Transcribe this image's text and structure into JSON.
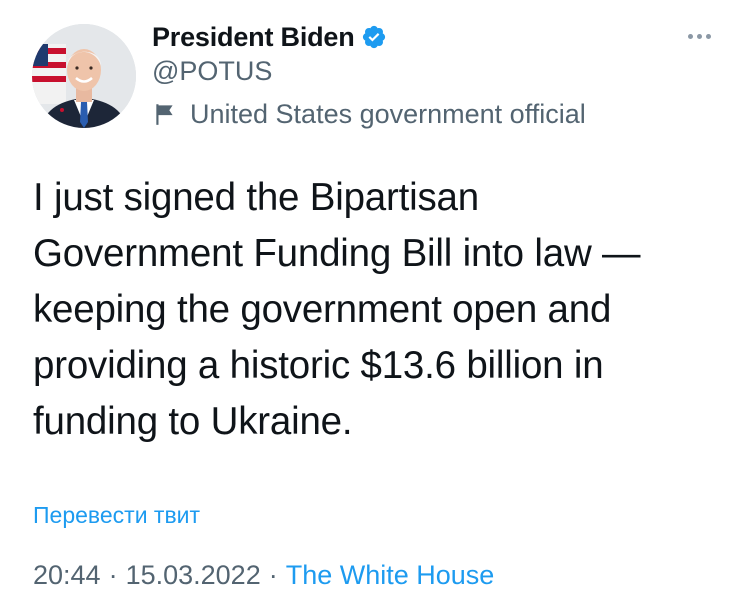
{
  "author": {
    "display_name": "President Biden",
    "handle": "@POTUS",
    "verified": true,
    "label": "United States government official",
    "label_icon": "flag-icon",
    "avatar_icon": "avatar"
  },
  "tweet": {
    "text": "I just signed the Bipartisan\nGovernment Funding Bill into law —\nkeeping the government open and\nproviding a historic $13.6 billion in\nfunding to Ukraine.",
    "translate_label": "Перевести твит"
  },
  "meta": {
    "time": "20:44",
    "separator": "·",
    "date": "15.03.2022",
    "source": "The White House"
  },
  "colors": {
    "accent": "#1d9bf0",
    "secondary_text": "#536471",
    "primary_text": "#0f1419"
  }
}
